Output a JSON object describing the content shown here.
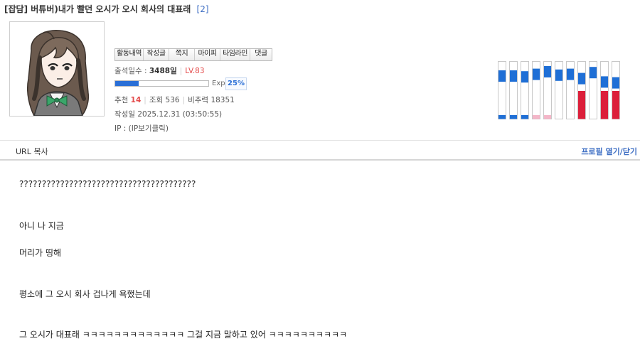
{
  "post": {
    "category": "[잡담]",
    "title": "버튜버)내가 빨던 오시가 오시 회사의 대표래",
    "comment_count": "[2]"
  },
  "profile": {
    "tabs": [
      "활동내역",
      "작성글",
      "쪽지",
      "마이피",
      "타임라인",
      "댓글"
    ],
    "attendance_label": "출석일수 :",
    "attendance_value": "3488일",
    "level": "LV.83",
    "exp_label": "Exp.",
    "exp_percent_text": "25%",
    "exp_progress": 0.25,
    "recommend_label": "추천",
    "recommend_value": "14",
    "views_label": "조회",
    "views_value": "536",
    "disrec_label": "비추력",
    "disrec_value": "18351",
    "date_label": "작성일",
    "date_value": "2025.12.31 (03:50:55)",
    "ip_label": "IP :",
    "ip_value": "(IP보기클릭)"
  },
  "activity_graph": {
    "colors": {
      "blue": "#1f6fd6",
      "red": "#dc1f3a",
      "pink": "#f4b6c8",
      "frame": "#c8c8c8"
    },
    "upper_levels": [
      0.5,
      0.5,
      0.45,
      0.6,
      0.75,
      0.55,
      0.6,
      0.35,
      0.7,
      0.15,
      0.1
    ],
    "lower": [
      {
        "color": "blue",
        "level": 0.15
      },
      {
        "color": "blue",
        "level": 0.15
      },
      {
        "color": "blue",
        "level": 0.15
      },
      {
        "color": "pink",
        "level": 0.15
      },
      {
        "color": "pink",
        "level": 0.15
      },
      {
        "color": "none",
        "level": 0
      },
      {
        "color": "none",
        "level": 0
      },
      {
        "color": "red",
        "level": 1.0
      },
      {
        "color": "none",
        "level": 0
      },
      {
        "color": "red",
        "level": 1.0
      },
      {
        "color": "red",
        "level": 1.0
      }
    ]
  },
  "actions": {
    "url_copy": "URL 복사",
    "profile_toggle": "프로필 열기/닫기"
  },
  "body_paragraphs": [
    "???????????????????????????????????????",
    "아니 나 지금",
    "머리가 띵해",
    "평소에 그 오시 회사 겁나게 욕했는데",
    "그 오시가 대표래 ㅋㅋㅋㅋㅋㅋㅋㅋㅋㅋㅋㅋㅋ 그걸 지금 말하고 있어 ㅋㅋㅋㅋㅋㅋㅋㅋㅋㅋ"
  ]
}
